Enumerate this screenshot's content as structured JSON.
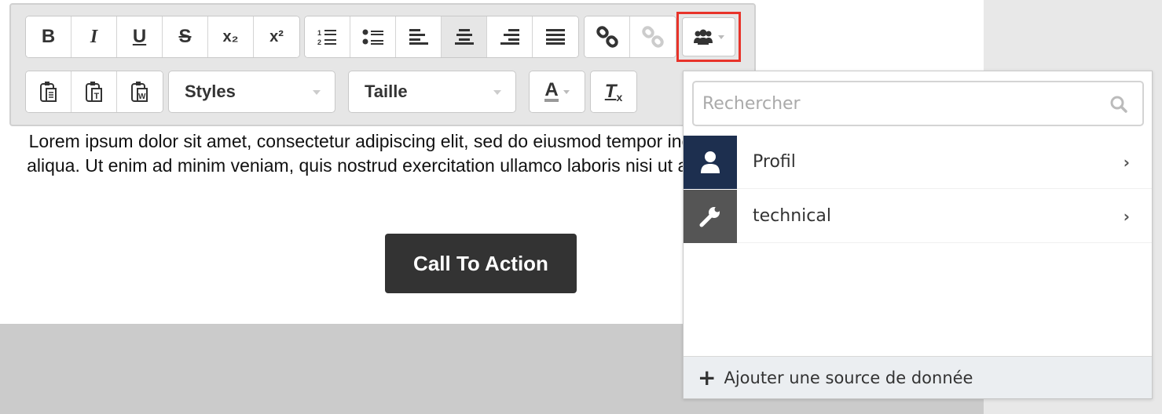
{
  "toolbar": {
    "format_buttons": [
      {
        "label": "B",
        "icon": "bold-icon"
      },
      {
        "label": "I",
        "icon": "italic-icon"
      },
      {
        "label": "U",
        "icon": "underline-icon"
      },
      {
        "label": "S",
        "icon": "strikethrough-icon"
      },
      {
        "label": "x₂",
        "icon": "subscript-icon"
      },
      {
        "label": "x²",
        "icon": "superscript-icon"
      }
    ],
    "list_align_buttons": [
      "numbered-list-icon",
      "bulleted-list-icon",
      "align-left-icon",
      "align-center-icon",
      "align-right-icon",
      "align-justify-icon"
    ],
    "active_alignment": "center",
    "styles_label": "Styles",
    "size_label": "Taille",
    "text_color_label": "A",
    "clear_format_label": "T"
  },
  "content": {
    "paragraph": "Lorem ipsum dolor sit amet, consectetur adipiscing elit, sed do eiusmod tempor incididunt ut labore et dolore magna aliqua. Ut enim ad minim veniam, quis nostrud exercitation ullamco laboris nisi ut aliquip ex ea commodo consequat.",
    "cta_label": "Call To Action"
  },
  "datasource_panel": {
    "search_placeholder": "Rechercher",
    "items": [
      {
        "label": "Profil",
        "icon": "user-icon",
        "color": "#1d2f4f"
      },
      {
        "label": "technical",
        "icon": "wrench-icon",
        "color": "#555555"
      }
    ],
    "add_label": "Ajouter une source de donnée"
  },
  "colors": {
    "highlight": "#e8332a"
  }
}
